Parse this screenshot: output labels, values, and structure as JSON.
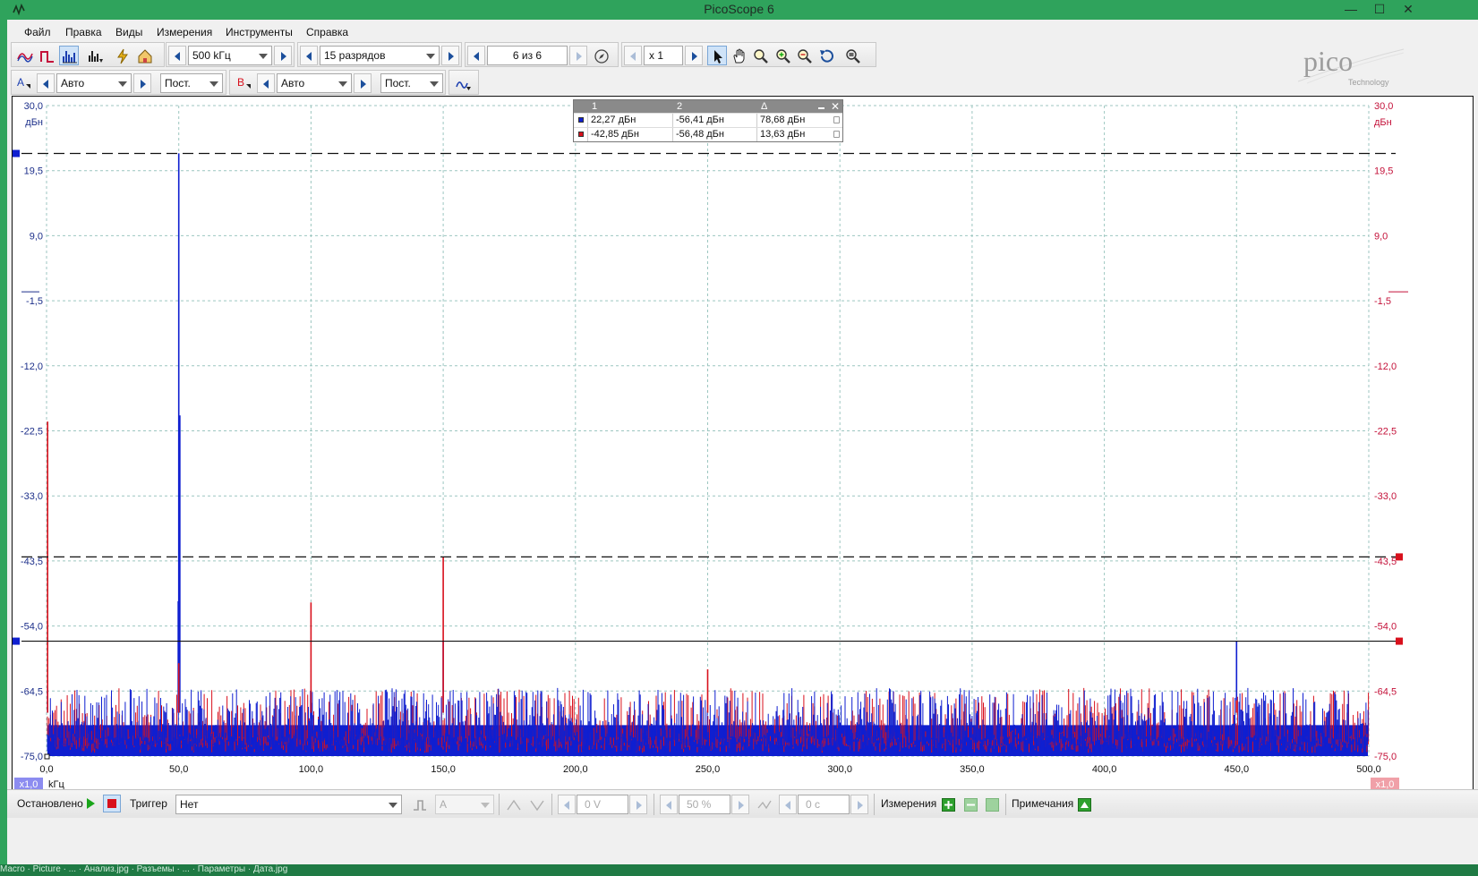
{
  "window": {
    "title": "PicoScope 6",
    "minimize": "—",
    "maximize": "☐",
    "close": "✕"
  },
  "menu": [
    "Файл",
    "Правка",
    "Виды",
    "Измерения",
    "Инструменты",
    "Справка"
  ],
  "toolbar1": {
    "timebase": "500 kГц",
    "resolution": "15 разрядов",
    "buffer": "6 из 6",
    "zoom": "x 1"
  },
  "toolbar2": {
    "channel_a": "A",
    "range_a": "Авто",
    "coupling_a": "Пост.",
    "channel_b": "B",
    "range_b": "Авто",
    "coupling_b": "Пост."
  },
  "logo": {
    "brand": "pico",
    "sub": "Technology"
  },
  "colors": {
    "channel_a": "#0f1fd0",
    "channel_b": "#d8101c",
    "grid": "#9cc6c0",
    "title_bar": "#2fa35c"
  },
  "measurements": {
    "headers": [
      "1",
      "2",
      "Δ"
    ],
    "rows": [
      {
        "channel": "A",
        "c1": "22,27 дБн",
        "c2": "-56,41 дБн",
        "delta": "78,68 дБн"
      },
      {
        "channel": "B",
        "c1": "-42,85 дБн",
        "c2": "-56,48 дБн",
        "delta": "13,63 дБн"
      }
    ]
  },
  "axis": {
    "y_unit": "дБн",
    "x_unit": "kГц",
    "scale_a": "x1,0",
    "scale_b": "x1,0"
  },
  "chart_data": {
    "type": "line",
    "xlabel": "kГц",
    "ylabel": "дБн",
    "xlim": [
      0,
      500
    ],
    "ylim": [
      -75,
      30
    ],
    "x_ticks": [
      "0,0",
      "50,0",
      "100,0",
      "150,0",
      "200,0",
      "250,0",
      "300,0",
      "350,0",
      "400,0",
      "450,0",
      "500,0"
    ],
    "y_ticks": [
      "30,0",
      "19,5",
      "9,0",
      "-1,5",
      "-12,0",
      "-22,5",
      "-33,0",
      "-43,5",
      "-54,0",
      "-64,5",
      "-75,0"
    ],
    "noise_floor": [
      -75,
      -64
    ],
    "series": [
      {
        "name": "A",
        "peaks": [
          {
            "x": 0.4,
            "y": -64
          },
          {
            "x": 50,
            "y": 22.3
          },
          {
            "x": 50.4,
            "y": -20
          },
          {
            "x": 49.8,
            "y": -50
          },
          {
            "x": 100,
            "y": -69
          },
          {
            "x": 150,
            "y": -56.4
          },
          {
            "x": 450,
            "y": -56.4
          }
        ]
      },
      {
        "name": "B",
        "peaks": [
          {
            "x": 0.4,
            "y": -21
          },
          {
            "x": 50,
            "y": -60
          },
          {
            "x": 100,
            "y": -50.2
          },
          {
            "x": 150,
            "y": -42.85
          },
          {
            "x": 250,
            "y": -61
          },
          {
            "x": 450,
            "y": -66
          }
        ]
      }
    ],
    "rulers": [
      {
        "y": 22.27,
        "style": "dashed"
      },
      {
        "y": -42.85,
        "style": "dashed"
      },
      {
        "y": -56.45,
        "style": "solid"
      }
    ],
    "grid": true
  },
  "status": {
    "state": "Остановлено",
    "trigger_label": "Триггер",
    "trigger_mode": "Нет",
    "trigger_source": "A",
    "level": "0 V",
    "pretrigger": "50 %",
    "delay": "0 c",
    "measurements": "Измерения",
    "notes": "Примечания"
  },
  "taskbar_text": "Macro   ·   Picture   ·   ...   ·   Анализ.jpg   ·   Разъемы   ·   ...   ·   Параметры   ·   Дата.jpg"
}
